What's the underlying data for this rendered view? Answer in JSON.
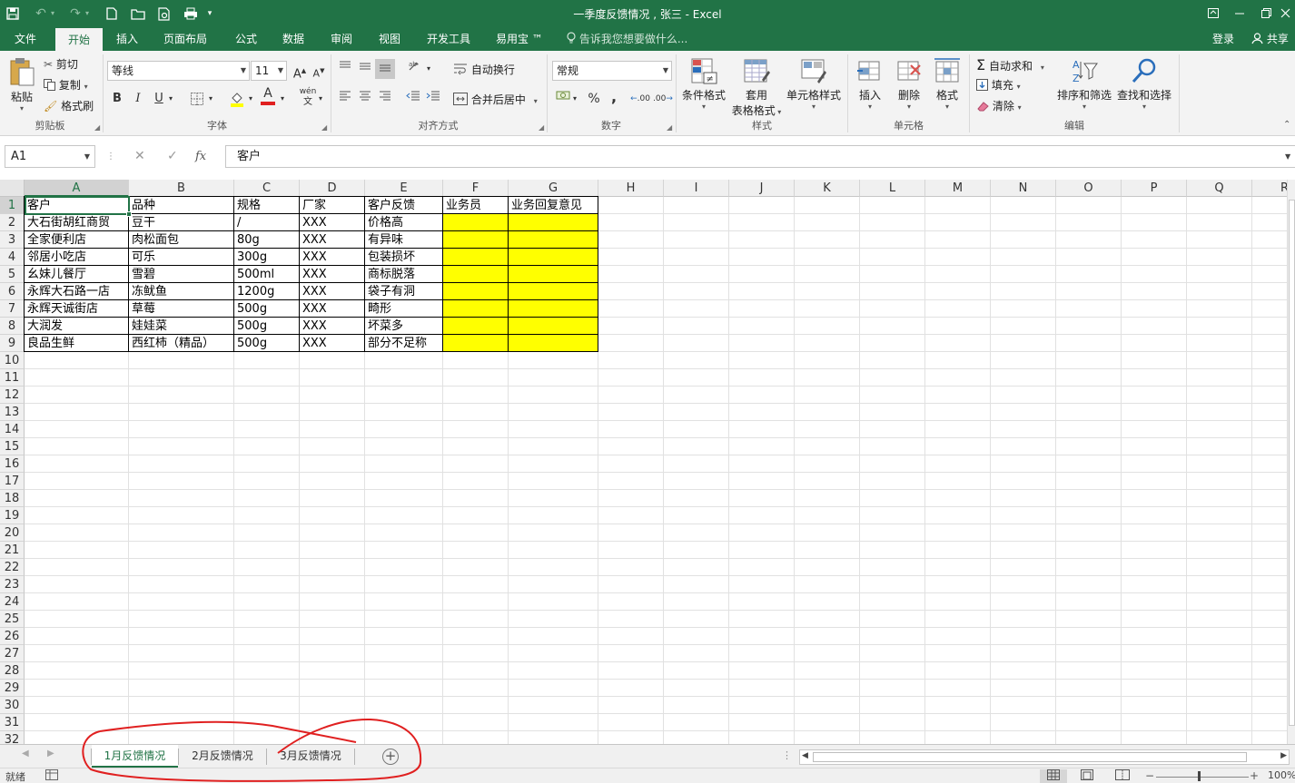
{
  "titlebar": {
    "title": "一季度反馈情况 , 张三 - Excel",
    "save_icon": "save-icon",
    "undo_icon": "undo-icon",
    "redo_icon": "redo-icon"
  },
  "menu": {
    "tabs": [
      "文件",
      "开始",
      "插入",
      "页面布局",
      "公式",
      "数据",
      "审阅",
      "视图",
      "开发工具",
      "易用宝 ™"
    ],
    "tell_me": "告诉我您想要做什么...",
    "login": "登录",
    "share": "共享"
  },
  "ribbon": {
    "clipboard": {
      "label": "剪贴板",
      "paste": "粘贴",
      "cut": "剪切",
      "copy": "复制",
      "format_painter": "格式刷"
    },
    "font": {
      "label": "字体",
      "font_name": "等线",
      "font_size": "11",
      "bold": "B",
      "italic": "I",
      "underline": "U",
      "grow": "A",
      "shrink": "A",
      "font_color": "A",
      "phonetic": "wén"
    },
    "alignment": {
      "label": "对齐方式",
      "wrap": "自动换行",
      "merge": "合并后居中"
    },
    "number": {
      "label": "数字",
      "format": "常规",
      "percent": "%",
      "comma": ",",
      "inc_decimal": ".00",
      "dec_decimal": ".00"
    },
    "styles": {
      "label": "样式",
      "conditional": "条件格式",
      "table_1": "套用",
      "table_2": "表格格式",
      "cell_styles": "单元格样式"
    },
    "cells": {
      "label": "单元格",
      "insert": "插入",
      "delete": "删除",
      "format": "格式"
    },
    "editing": {
      "label": "编辑",
      "autosum": "自动求和",
      "fill": "填充",
      "clear": "清除",
      "sort": "排序和筛选",
      "find": "查找和选择"
    }
  },
  "formula_bar": {
    "name_box": "A1",
    "formula": "客户",
    "fx": "fx"
  },
  "grid": {
    "columns": [
      "A",
      "B",
      "C",
      "D",
      "E",
      "F",
      "G",
      "H",
      "I",
      "J",
      "K",
      "L",
      "M",
      "N",
      "O",
      "P",
      "Q",
      "R"
    ],
    "rows": [
      "1",
      "2",
      "3",
      "4",
      "5",
      "6",
      "7",
      "8",
      "9",
      "10",
      "11",
      "12",
      "13",
      "14",
      "15",
      "16",
      "17",
      "18",
      "19",
      "20",
      "21",
      "22",
      "23",
      "24",
      "25",
      "26",
      "27",
      "28",
      "29",
      "30",
      "31",
      "32"
    ],
    "headers": [
      "客户",
      "品种",
      "规格",
      "厂家",
      "客户反馈",
      "业务员",
      "业务回复意见"
    ],
    "data": [
      [
        "大石街胡红商贸",
        "豆干",
        "/",
        "XXX",
        "价格高"
      ],
      [
        "全家便利店",
        "肉松面包",
        "80g",
        "XXX",
        "有异味"
      ],
      [
        "邻居小吃店",
        "可乐",
        "300g",
        "XXX",
        "包装损坏"
      ],
      [
        "幺妹儿餐厅",
        "雪碧",
        "500ml",
        "XXX",
        "商标脱落"
      ],
      [
        "永辉大石路一店",
        "冻鱿鱼",
        "1200g",
        "XXX",
        "袋子有洞"
      ],
      [
        "永辉天诚街店",
        "草莓",
        "500g",
        "XXX",
        "畸形"
      ],
      [
        "大润发",
        "娃娃菜",
        "500g",
        "XXX",
        "坏菜多"
      ],
      [
        "良品生鲜",
        "西红柿（精品）",
        "500g",
        "XXX",
        "部分不足称"
      ]
    ],
    "highlight_color": "#FFFF00"
  },
  "sheets": {
    "tabs": [
      "1月反馈情况",
      "2月反馈情况",
      "3月反馈情况"
    ],
    "active": "1月反馈情况",
    "add_icon": "plus-circle-icon"
  },
  "status": {
    "ready": "就绪",
    "zoom": "100%"
  },
  "colors": {
    "excel_green": "#217346",
    "annotation_red": "#E02020"
  }
}
